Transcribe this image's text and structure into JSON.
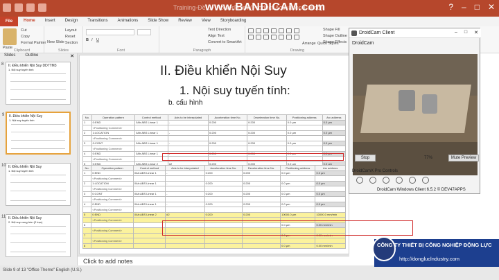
{
  "window": {
    "title": "Training-Đề... - PowerPoint (Product Activation Failed)",
    "watermark": "www.BANDICAM.com"
  },
  "ribbon": {
    "file_tab": "File",
    "tabs": [
      "Home",
      "Insert",
      "Design",
      "Transitions",
      "Animations",
      "Slide Show",
      "Review",
      "View",
      "Storyboarding"
    ],
    "clipboard": {
      "paste": "Paste",
      "cut": "Cut",
      "copy": "Copy",
      "format_painter": "Format Painter",
      "label": "Clipboard"
    },
    "slides": {
      "new_slide": "New Slide",
      "layout": "Layout",
      "reset": "Reset",
      "section": "Section",
      "label": "Slides"
    },
    "font_label": "Font",
    "paragraph": {
      "text_direction": "Text Direction",
      "align_text": "Align Text",
      "convert": "Convert to SmartArt",
      "label": "Paragraph"
    },
    "drawing": {
      "arrange": "Arrange",
      "quick_styles": "Quick Styles",
      "shape_fill": "Shape Fill",
      "shape_outline": "Shape Outline",
      "shape_effects": "Shape Effects",
      "label": "Drawing"
    }
  },
  "slides_pane": {
    "tab_slides": "Slides",
    "tab_outline": "Outline",
    "thumbs": [
      {
        "num": "8",
        "title": "II. Điều khiển Nội Suy DD7TM3",
        "sub": "1. Nội suy tuyến tính"
      },
      {
        "num": "9",
        "title": "II. Điều khiển Nội Suy",
        "sub": "1. Nội suy tuyến tính"
      },
      {
        "num": "10",
        "title": "II. Điều khiển Nội Suy",
        "sub": "1. Nội suy tuyến tính"
      },
      {
        "num": "11",
        "title": "II. Điều khiển Nội Suy",
        "sub": "2. Nội suy cung tròn (2 trục)"
      }
    ]
  },
  "slide": {
    "title": "II. Điều khiển Nội Suy",
    "subtitle": "1. Nội suy tuyến tính:",
    "bullet": "b. cấu hình",
    "table_headers": [
      "No.",
      "Operation pattern",
      "Control method",
      "Axis to be interpolated",
      "Acceleration time No.",
      "Deceleration time No.",
      "Positioning address",
      "Arc address"
    ],
    "table1": [
      [
        "1",
        "0:END",
        "0Ah:ABS Linear 1",
        "-",
        "0:200",
        "0:200",
        "0.0 µm",
        "0.0 µm"
      ],
      [
        "",
        "<Positioning Comment>",
        "",
        "",
        "",
        "",
        "",
        ""
      ],
      [
        "2",
        "1:LOCATION",
        "0Ah:ABS Linear 1",
        "-",
        "0:200",
        "0:200",
        "0.0 µm",
        "0.0 µm"
      ],
      [
        "",
        "<Positioning Comment>",
        "",
        "",
        "",
        "",
        "",
        ""
      ],
      [
        "3",
        "0:CONT",
        "0Ah:ABS Linear 1",
        "-",
        "0:200",
        "0:200",
        "0.0 µm",
        "0.0 µm"
      ],
      [
        "",
        "<Positioning Comment>",
        "",
        "",
        "",
        "",
        "",
        ""
      ],
      [
        "4",
        "0:END",
        "0Ah:ABS Linear 1",
        "-",
        "0:200",
        "0:200",
        "0.0 µm",
        "0.0 µm"
      ],
      [
        "",
        "<Positioning Comment>",
        "",
        "",
        "",
        "",
        "",
        ""
      ],
      [
        "5",
        "0:END",
        "0Ah:ABS Linear 2",
        "#2",
        "0:200",
        "0:200",
        "0.0 µm",
        "0.0 µm"
      ]
    ],
    "table2": [
      [
        "1",
        "0:END",
        "0Ah:ABS Linear 1",
        "-",
        "0:200",
        "0:200",
        "0.0 µm",
        "0.0 µm"
      ],
      [
        "",
        "<Positioning Comment>",
        "",
        "",
        "",
        "",
        "",
        ""
      ],
      [
        "2",
        "1:LOCATION",
        "0Ah:ABS Linear 1",
        "-",
        "0:200",
        "0:200",
        "0.0 µm",
        "0.0 µm"
      ],
      [
        "",
        "<Positioning Comment>",
        "",
        "",
        "",
        "",
        "",
        ""
      ],
      [
        "3",
        "0:CONT",
        "0Ah:ABS Linear 1",
        "-",
        "0:200",
        "0:200",
        "0.0 µm",
        "0.0 µm"
      ],
      [
        "",
        "<Positioning Comment>",
        "",
        "",
        "",
        "",
        "",
        ""
      ],
      [
        "4",
        "0:END",
        "0Ah:ABS Linear 1",
        "-",
        "0:200",
        "0:200",
        "0.0 µm",
        "0.0 µm"
      ],
      [
        "",
        "<Positioning Comment>",
        "",
        "",
        "",
        "",
        "",
        ""
      ],
      [
        "5",
        "0:END",
        "0Ah:ABS Linear 2",
        "#2",
        "0:200",
        "0:200",
        "10000.0 µm",
        "10000.0 mm/min"
      ],
      [
        "",
        "<Positioning Comment>",
        "",
        "",
        "",
        "",
        "",
        ""
      ],
      [
        "6",
        "",
        "",
        "",
        "",
        "",
        "0.0 µm",
        "0.00 mm/min"
      ],
      [
        "",
        "<Positioning Comment>",
        "",
        "",
        "",
        "",
        "",
        ""
      ],
      [
        "7",
        "",
        "",
        "",
        "",
        "",
        "0.0 µm",
        "0.00 mm/min"
      ],
      [
        "",
        "<Positioning Comment>",
        "",
        "",
        "",
        "",
        "",
        ""
      ],
      [
        "8",
        "",
        "",
        "",
        "",
        "",
        "0.0 µm",
        "0.00 mm/min"
      ]
    ],
    "notes_placeholder": "Click to add notes"
  },
  "status": {
    "text": "Slide 9 of 13   \"Office Theme\"   English (U.S.)"
  },
  "droidcam": {
    "title": "DroidCam Client",
    "menu": "DroidCam",
    "stop": "Stop",
    "zoom": "77%",
    "mute": "Mute Preview",
    "controls_label": "DroidCamX Pro Controls",
    "version": "DroidCam Windows Client 6.5.2 © DEV47APPS"
  },
  "banner": {
    "company": "CÔNG TY THIẾT BỊ CÔNG NGHIỆP ĐỘNG LỰC",
    "website": "http://dongluclndustry.com"
  }
}
